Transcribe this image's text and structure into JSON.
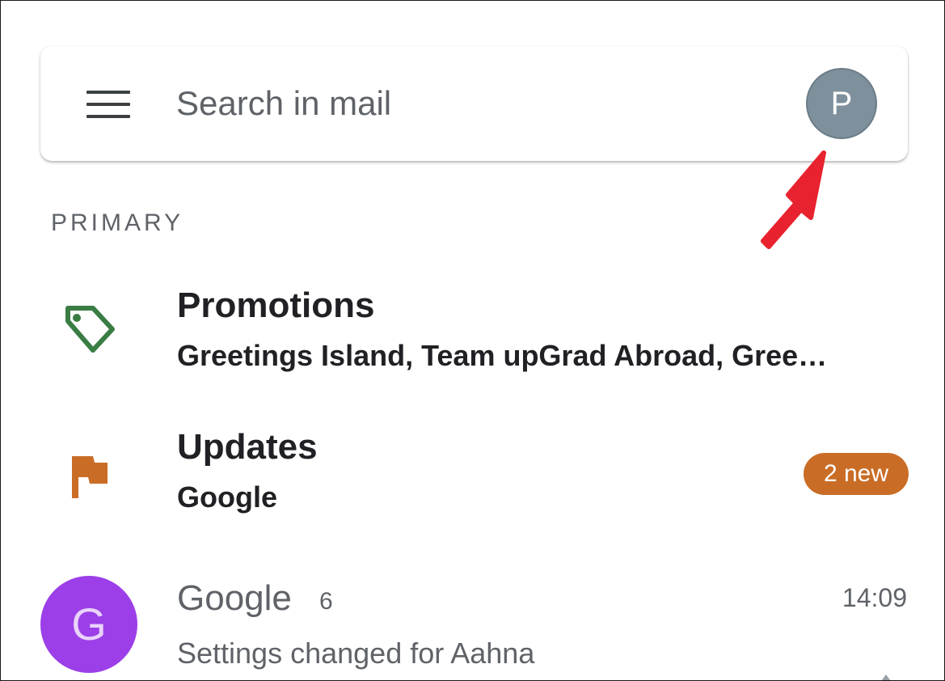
{
  "search": {
    "placeholder": "Search in mail"
  },
  "account": {
    "initial": "P",
    "avatar_color": "#7e909c"
  },
  "annotation": {
    "arrow_color": "#e8222e"
  },
  "section": {
    "label": "PRIMARY"
  },
  "categories": [
    {
      "title": "Promotions",
      "senders": "Greetings Island, Team upGrad Abroad, Gree…",
      "icon": "tag-icon",
      "icon_color": "#3a7d44"
    },
    {
      "title": "Updates",
      "senders": "Google",
      "badge": "2 new",
      "icon": "flag-icon",
      "icon_color": "#c96d26"
    }
  ],
  "emails": [
    {
      "avatar_initial": "G",
      "avatar_color": "#9c3fe8",
      "sender": "Google",
      "count": "6",
      "time": "14:09",
      "snippet": "Settings changed for Aahna"
    }
  ]
}
